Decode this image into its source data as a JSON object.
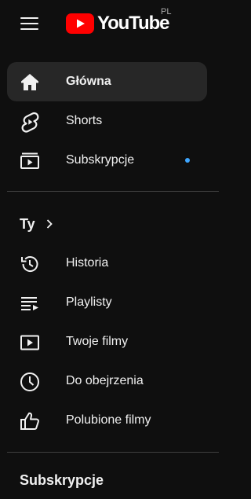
{
  "header": {
    "logo_text": "YouTube",
    "region": "PL"
  },
  "main_nav": [
    {
      "label": "Główna",
      "icon": "home-icon",
      "active": true
    },
    {
      "label": "Shorts",
      "icon": "shorts-icon",
      "active": false
    },
    {
      "label": "Subskrypcje",
      "icon": "subscriptions-icon",
      "active": false,
      "badge": true
    }
  ],
  "you_section": {
    "title": "Ty",
    "items": [
      {
        "label": "Historia",
        "icon": "history-icon"
      },
      {
        "label": "Playlisty",
        "icon": "playlists-icon"
      },
      {
        "label": "Twoje filmy",
        "icon": "your-videos-icon"
      },
      {
        "label": "Do obejrzenia",
        "icon": "watch-later-icon"
      },
      {
        "label": "Polubione filmy",
        "icon": "liked-videos-icon"
      }
    ]
  },
  "subscriptions_section": {
    "title": "Subskrypcje"
  },
  "colors": {
    "background": "#0f0f0f",
    "active_item": "#272727",
    "brand_red": "#ff0000",
    "badge_dot": "#3ea6ff",
    "divider": "#3f3f3f"
  }
}
